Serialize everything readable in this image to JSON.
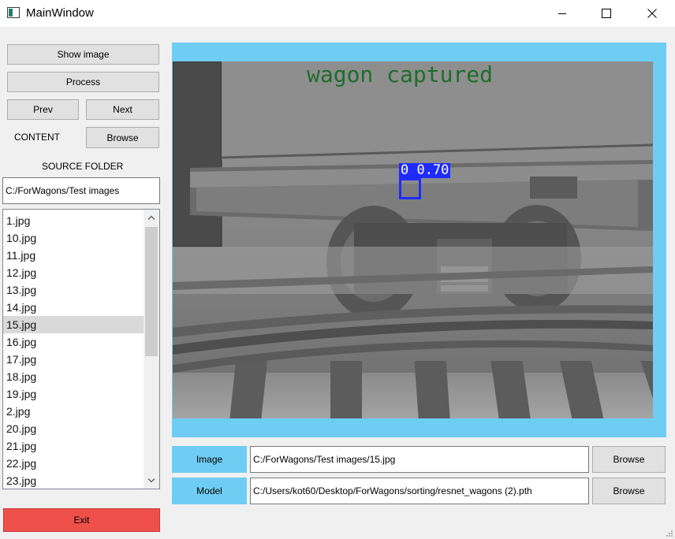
{
  "window": {
    "title": "MainWindow",
    "controls": {
      "minimize": "minimize-icon",
      "maximize": "maximize-icon",
      "close": "close-icon"
    }
  },
  "left_panel": {
    "show_image_label": "Show image",
    "process_label": "Process",
    "prev_label": "Prev",
    "next_label": "Next",
    "content_label": "CONTENT",
    "content_browse_label": "Browse",
    "source_folder_label": "SOURCE FOLDER",
    "source_folder_value": "C:/ForWagons/Test images",
    "files": [
      "1.jpg",
      "10.jpg",
      "11.jpg",
      "12.jpg",
      "13.jpg",
      "14.jpg",
      "15.jpg",
      "16.jpg",
      "17.jpg",
      "18.jpg",
      "19.jpg",
      "2.jpg",
      "20.jpg",
      "21.jpg",
      "22.jpg",
      "23.jpg"
    ],
    "selected_file": "15.jpg",
    "exit_label": "Exit"
  },
  "viewer": {
    "overlay_text": "wagon captured",
    "detection_label": "0 0.70",
    "frame_color": "#6fcdf3",
    "overlay_color": "#1f6d2b",
    "box_color": "#1e2cff"
  },
  "paths": {
    "image_label": "Image",
    "image_value": "C:/ForWagons/Test images/15.jpg",
    "image_browse_label": "Browse",
    "model_label": "Model",
    "model_value": "C:/Users/kot60/Desktop/ForWagons/sorting/resnet_wagons (2).pth",
    "model_browse_label": "Browse"
  },
  "colors": {
    "exit_button": "#f0504a",
    "accent": "#6fcdf3"
  }
}
